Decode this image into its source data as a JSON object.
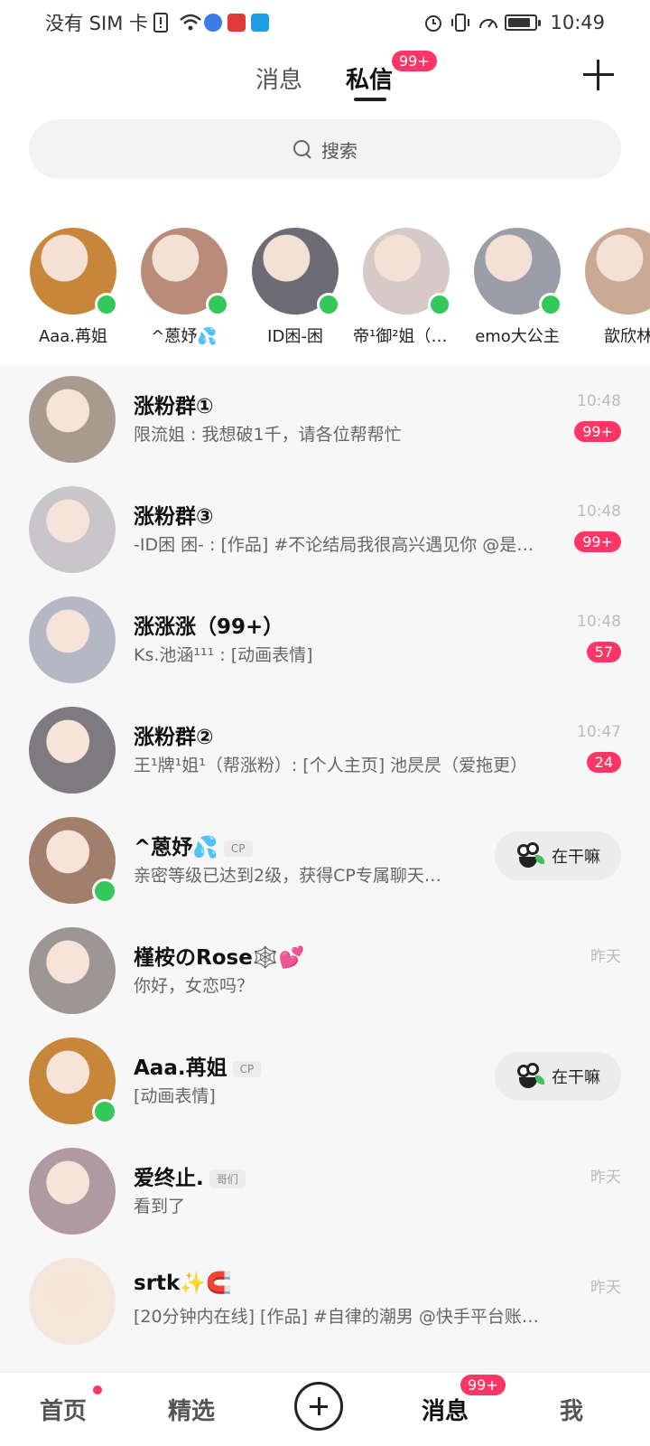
{
  "status_bar": {
    "carrier": "没有 SIM 卡",
    "time": "10:49",
    "battery_level": 0.85
  },
  "header": {
    "tab_messages": "消息",
    "tab_dm": "私信",
    "dm_badge": "99+",
    "add_icon": "plus-icon"
  },
  "search": {
    "placeholder": "搜索"
  },
  "stories": [
    {
      "name": "Aaa.苒姐",
      "online": true,
      "color": "#c8863a"
    },
    {
      "name": "^蒽妤💦",
      "online": true,
      "color": "#b88c78"
    },
    {
      "name": "ID困-困",
      "online": true,
      "color": "#6d6b73"
    },
    {
      "name": "帝¹御²姐（冲…",
      "online": true,
      "color": "#d7c9c8"
    },
    {
      "name": "emo大公主",
      "online": true,
      "color": "#9b9ea8"
    },
    {
      "name": "歆欣林",
      "online": false,
      "color": "#c9a894"
    }
  ],
  "conversations": [
    {
      "title": "涨粉群①",
      "preview": "限流姐 : 我想破1千，请各位帮帮忙",
      "time": "10:48",
      "count": "99+",
      "color": "#a79b8f"
    },
    {
      "title": "涨粉群③",
      "preview": "-ID困 困- : [作品] #不论结局我很高兴遇见你 @是…",
      "time": "10:48",
      "count": "99+",
      "color": "#c8c6c9"
    },
    {
      "title": "涨涨涨（99+）",
      "preview": "Ks.池涵¹¹¹ : [动画表情]",
      "time": "10:48",
      "count": "57",
      "color": "#b6b7c4"
    },
    {
      "title": "涨粉群②",
      "preview": "王¹牌¹姐¹（帮涨粉）: [个人主页] 池昃昃（爱拖更）",
      "time": "10:47",
      "count": "24",
      "color": "#7d7a80"
    },
    {
      "title": "^蒽妤💦",
      "tag": "CP",
      "preview": "亲密等级已达到2级，获得CP专属聊天…",
      "action": "在干嘛",
      "online": true,
      "color": "#a47e6c"
    },
    {
      "title": "槿桉のRose🕸️💕",
      "preview": "你好，女恋吗？",
      "time": "昨天",
      "color": "#9c9794"
    },
    {
      "title": "Aaa.苒姐",
      "tag": "CP",
      "preview": "[动画表情]",
      "action": "在干嘛",
      "online": true,
      "color": "#c8863a"
    },
    {
      "title": "爱终止.",
      "tag": "哥们",
      "preview": "看到了",
      "time": "昨天",
      "color": "#b09aa2"
    },
    {
      "title": "srtk✨🧲",
      "preview": "[20分钟内在线] [作品] #自律的潮男 @快手平台账号 官…",
      "time": "昨天",
      "color": "#f3e6da"
    }
  ],
  "bottom_nav": {
    "home": "首页",
    "featured": "精选",
    "messages": "消息",
    "messages_badge": "99+",
    "me": "我"
  }
}
